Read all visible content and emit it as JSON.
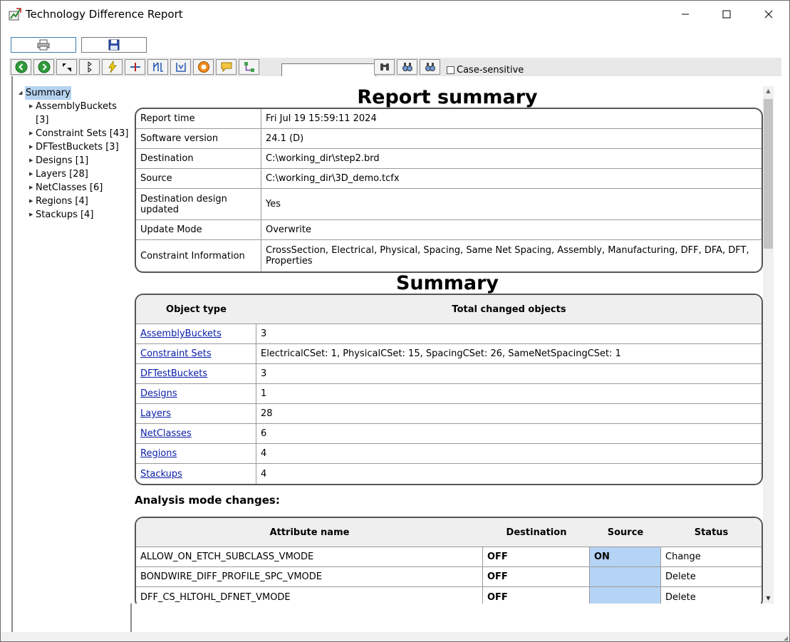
{
  "window": {
    "title": "Technology Difference Report",
    "minimize_glyph": "—",
    "maximize_glyph": "☐",
    "close_glyph": "✕"
  },
  "toolbar": {
    "search_value": "",
    "case_sensitive_label": "Case-sensitive",
    "case_sensitive_checked": false,
    "buttons": [
      "back-icon",
      "forward-icon",
      "expand-all-icon",
      "collapse-all-icon",
      "lightning-icon",
      "add-icon",
      "filter-icon",
      "filter-alt-icon",
      "target-icon",
      "comment-icon",
      "tree-icon",
      "binoculars-icon",
      "find-next-icon",
      "find-prev-icon"
    ]
  },
  "tree": {
    "root": "Summary",
    "items": [
      {
        "label": "AssemblyBuckets [3]"
      },
      {
        "label": "Constraint Sets [43]"
      },
      {
        "label": "DFTestBuckets [3]"
      },
      {
        "label": "Designs [1]"
      },
      {
        "label": "Layers [28]"
      },
      {
        "label": "NetClasses [6]"
      },
      {
        "label": "Regions [4]"
      },
      {
        "label": "Stackups [4]"
      }
    ]
  },
  "report": {
    "title": "Report summary",
    "rows": [
      {
        "k": "Report time",
        "v": "Fri Jul 19 15:59:11 2024"
      },
      {
        "k": "Software version",
        "v": "24.1 (D)"
      },
      {
        "k": "Destination",
        "v": "C:\\working_dir\\step2.brd"
      },
      {
        "k": "Source",
        "v": "C:\\working_dir\\3D_demo.tcfx"
      },
      {
        "k": "Destination design updated",
        "v": "Yes"
      },
      {
        "k": "Update Mode",
        "v": "Overwrite"
      },
      {
        "k": "Constraint Information",
        "v": "CrossSection, Electrical, Physical, Spacing, Same Net Spacing, Assembly, Manufacturing, DFF, DFA, DFT, Properties"
      }
    ]
  },
  "summary": {
    "title": "Summary",
    "headers": [
      "Object type",
      "Total changed objects"
    ],
    "rows": [
      {
        "type": "AssemblyBuckets",
        "total": "3"
      },
      {
        "type": "Constraint Sets",
        "total": "ElectricalCSet: 1, PhysicalCSet: 15, SpacingCSet: 26, SameNetSpacingCSet: 1"
      },
      {
        "type": "DFTestBuckets",
        "total": "3"
      },
      {
        "type": "Designs",
        "total": "1"
      },
      {
        "type": "Layers",
        "total": "28"
      },
      {
        "type": "NetClasses",
        "total": "6"
      },
      {
        "type": "Regions",
        "total": "4"
      },
      {
        "type": "Stackups",
        "total": "4"
      }
    ]
  },
  "analysis": {
    "title": "Analysis mode changes:",
    "headers": [
      "Attribute name",
      "Destination",
      "Source",
      "Status"
    ],
    "rows": [
      {
        "name": "ALLOW_ON_ETCH_SUBCLASS_VMODE",
        "dest": "OFF",
        "src": "ON",
        "status": "Change"
      },
      {
        "name": "BONDWIRE_DIFF_PROFILE_SPC_VMODE",
        "dest": "OFF",
        "src": "",
        "status": "Delete"
      },
      {
        "name": "DFF_CS_HLTOHL_DFNET_VMODE",
        "dest": "OFF",
        "src": "",
        "status": "Delete"
      }
    ]
  },
  "colors": {
    "link": "#0b1ea8",
    "source_highlight": "#b5d3f4",
    "selection": "#b5d3f0"
  }
}
